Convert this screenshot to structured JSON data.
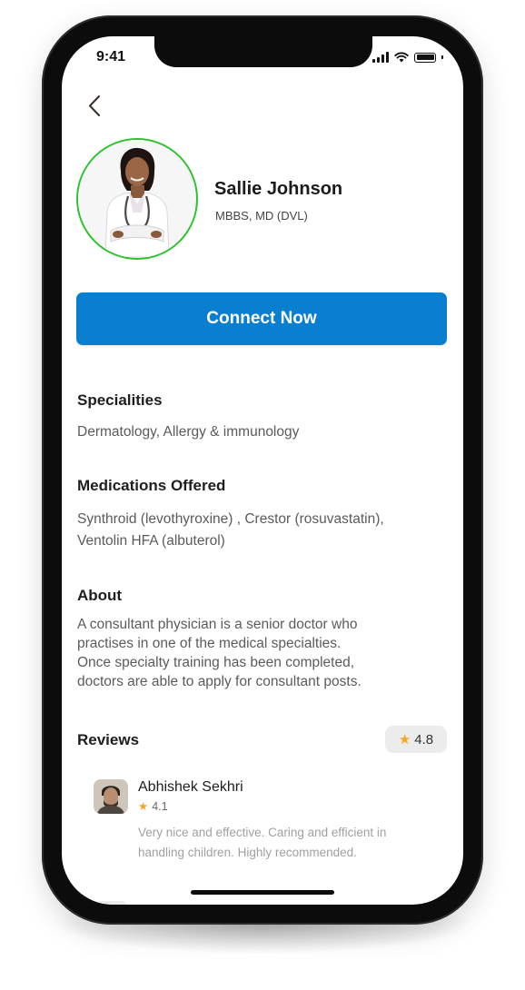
{
  "status_bar": {
    "time": "9:41"
  },
  "doctor": {
    "name": "Sallie Johnson",
    "degree": "MBBS, MD (DVL)"
  },
  "actions": {
    "connect_label": "Connect Now"
  },
  "specialities": {
    "title": "Specialities",
    "text": "Dermatology, Allergy & immunology"
  },
  "medications": {
    "title": "Medications Offered",
    "line1": "Synthroid (levothyroxine) , Crestor (rosuvastatin),",
    "line2": "Ventolin HFA (albuterol)"
  },
  "about": {
    "title": "About",
    "line1": "A consultant physician is a senior doctor who",
    "line2": "practises in one of the medical specialties.",
    "line3": "Once specialty training has been completed,",
    "line4": "doctors are able to apply for consultant posts."
  },
  "reviews": {
    "title": "Reviews",
    "overall_rating": "4.8",
    "items": [
      {
        "name": "Abhishek Sekhri",
        "rating": "4.1",
        "line1": "Very nice and effective. Caring and efficient in",
        "line2": "handling children. Highly recommended."
      }
    ]
  },
  "icons": {
    "back": "chevron-left-icon",
    "star": "star-icon",
    "signal": "cellular-signal-icon",
    "wifi": "wifi-icon",
    "battery": "battery-icon"
  },
  "colors": {
    "primary": "#0a7fcf",
    "avatar_ring": "#2dc22d",
    "star": "#f5a623"
  }
}
